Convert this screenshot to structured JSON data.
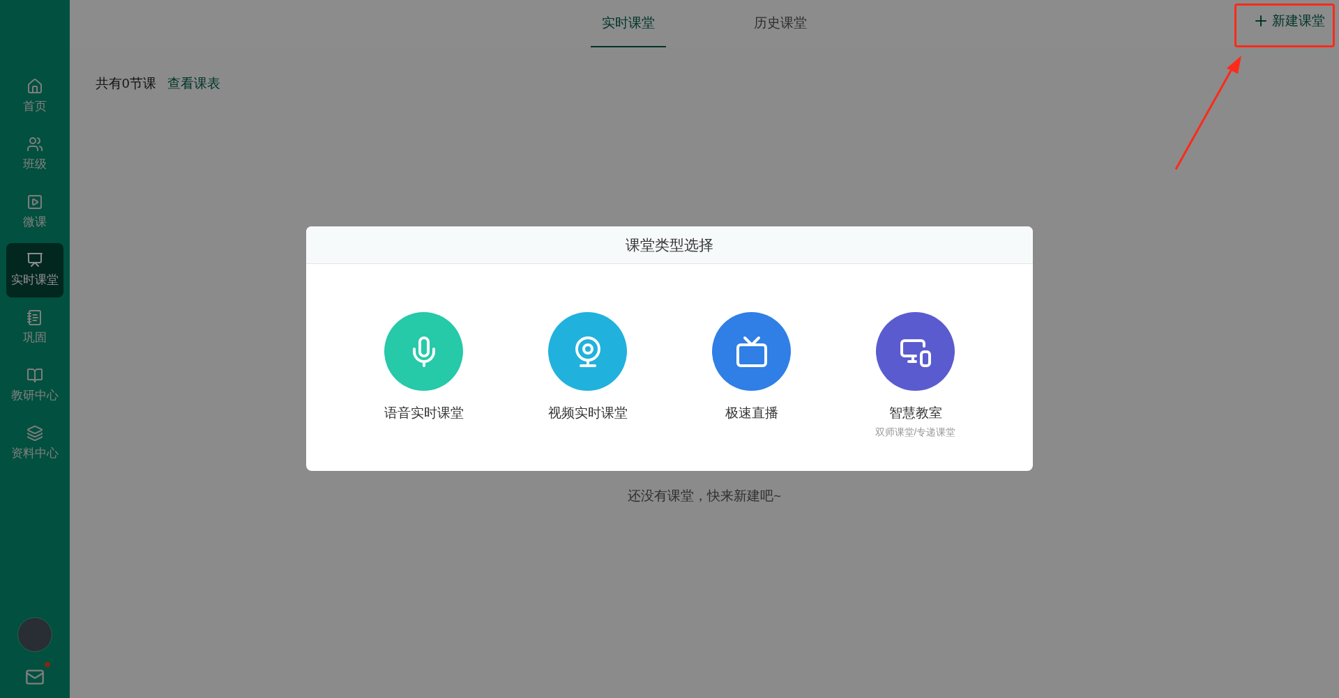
{
  "sidebar": {
    "items": [
      {
        "label": "首页",
        "selected": false
      },
      {
        "label": "班级",
        "selected": false
      },
      {
        "label": "微课",
        "selected": false
      },
      {
        "label": "实时课堂",
        "selected": true
      },
      {
        "label": "巩固",
        "selected": false
      },
      {
        "label": "教研中心",
        "selected": false
      },
      {
        "label": "资料中心",
        "selected": false
      }
    ],
    "mail": {
      "unread": true
    }
  },
  "tabs": [
    {
      "label": "实时课堂",
      "selected": true
    },
    {
      "label": "历史课堂",
      "selected": false
    }
  ],
  "new_button": {
    "label": "新建课堂"
  },
  "summary": {
    "count_text": "共有0节课",
    "link": "查看课表"
  },
  "empty_text": "还没有课堂，快来新建吧~",
  "modal": {
    "title": "课堂类型选择",
    "options": [
      {
        "kind": "voice",
        "label": "语音实时课堂",
        "color": "#26c9a8"
      },
      {
        "kind": "video",
        "label": "视频实时课堂",
        "color": "#21b1dd"
      },
      {
        "kind": "live",
        "label": "极速直播",
        "color": "#2f7fe6"
      },
      {
        "kind": "smart",
        "label": "智慧教室",
        "subtitle": "双师课堂/专递课堂",
        "color": "#5b5bd0"
      }
    ]
  }
}
